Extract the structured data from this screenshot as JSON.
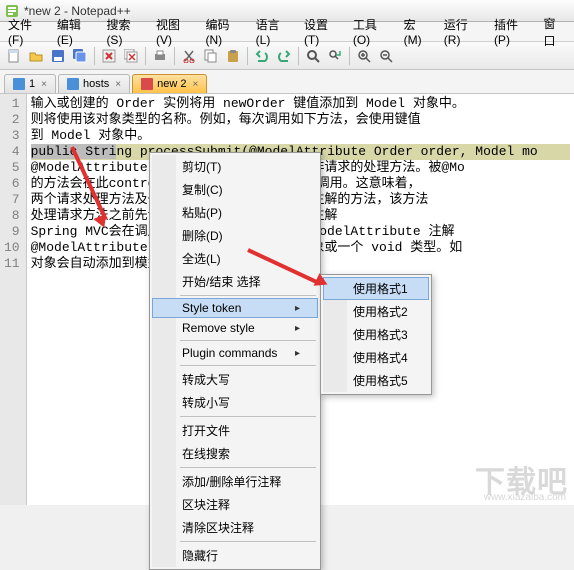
{
  "window": {
    "title": "*new 2 - Notepad++"
  },
  "menubar": {
    "items": [
      {
        "label": "文件(F)"
      },
      {
        "label": "编辑(E)"
      },
      {
        "label": "搜索(S)"
      },
      {
        "label": "视图(V)"
      },
      {
        "label": "编码(N)"
      },
      {
        "label": "语言(L)"
      },
      {
        "label": "设置(T)"
      },
      {
        "label": "工具(O)"
      },
      {
        "label": "宏(M)"
      },
      {
        "label": "运行(R)"
      },
      {
        "label": "插件(P)"
      },
      {
        "label": "窗口"
      }
    ]
  },
  "tabs": {
    "items": [
      {
        "label": "1",
        "active": false,
        "icon": "file-icon-blue"
      },
      {
        "label": "hosts",
        "active": false,
        "icon": "file-icon-blue"
      },
      {
        "label": "new 2",
        "active": true,
        "icon": "file-icon-red"
      }
    ]
  },
  "gutter": {
    "lines": [
      "1",
      "2",
      "3",
      "4",
      "5",
      "6",
      "7",
      "8",
      "9",
      "10",
      "11"
    ]
  },
  "code": {
    "lines": [
      "输入或创建的 Order 实例将用 newOrder 键值添加到 Model 对象中。",
      "则将使用该对象类型的名称。例如，每次调用如下方法，会使用键值",
      "到 Model 对象中。",
      "public String processSubmit(@ModelAttribute Order order, Model mo",
      "@ModelAttribute 注解也可以被用来标注一个非请求的处理方法。被@Mo",
      "的方法会在此controller每个请求处理方法时被调用。这意味着，",
      "两个请求处理方法及一个有@ModelAttribute 注解的方法，该方法",
      "处理请求方法之前先调用带@ModelAttribute 注解",
      "Spring MVC会在调用请求处理方法之前调用带@ModelAttribute 注解",
      "@ModelAttribute 注解的方法可以返回一个对象或一个 void 类型。如",
      "对象会自动添加到模型中。"
    ],
    "highlight_line_index": 3,
    "selection_text": "public Stri"
  },
  "context_menu": {
    "items": [
      {
        "label": "剪切(T)",
        "kind": "item"
      },
      {
        "label": "复制(C)",
        "kind": "item"
      },
      {
        "label": "粘贴(P)",
        "kind": "item"
      },
      {
        "label": "删除(D)",
        "kind": "item"
      },
      {
        "label": "全选(L)",
        "kind": "item"
      },
      {
        "label": "开始/结束 选择",
        "kind": "item"
      },
      {
        "kind": "sep"
      },
      {
        "label": "Style token",
        "kind": "submenu",
        "hover": true
      },
      {
        "label": "Remove style",
        "kind": "submenu"
      },
      {
        "kind": "sep"
      },
      {
        "label": "Plugin commands",
        "kind": "submenu"
      },
      {
        "kind": "sep"
      },
      {
        "label": "转成大写",
        "kind": "item"
      },
      {
        "label": "转成小写",
        "kind": "item"
      },
      {
        "kind": "sep"
      },
      {
        "label": "打开文件",
        "kind": "item"
      },
      {
        "label": "在线搜索",
        "kind": "item"
      },
      {
        "kind": "sep"
      },
      {
        "label": "添加/删除单行注释",
        "kind": "item"
      },
      {
        "label": "区块注释",
        "kind": "item"
      },
      {
        "label": "清除区块注释",
        "kind": "item"
      },
      {
        "kind": "sep"
      },
      {
        "label": "隐藏行",
        "kind": "item"
      }
    ]
  },
  "submenu": {
    "items": [
      {
        "label": "使用格式1",
        "hover": true
      },
      {
        "label": "使用格式2"
      },
      {
        "label": "使用格式3"
      },
      {
        "label": "使用格式4"
      },
      {
        "label": "使用格式5"
      }
    ]
  },
  "toolbar": {
    "icons": [
      "new-file-icon",
      "open-file-icon",
      "save-icon",
      "save-all-icon",
      "sep",
      "close-icon",
      "close-all-icon",
      "sep",
      "print-icon",
      "sep",
      "cut-icon",
      "copy-icon",
      "paste-icon",
      "sep",
      "undo-icon",
      "redo-icon",
      "sep",
      "find-icon",
      "replace-icon",
      "sep",
      "zoom-in-icon",
      "zoom-out-icon"
    ]
  },
  "watermark": {
    "text": "下载吧",
    "url": "www.xiazaiba.com"
  },
  "colors": {
    "tab_active_bg": "#ffc24a",
    "selection_bg": "#bcbcbc",
    "line_hl": "#d7d7a8",
    "menu_hover": "#c7ddf5",
    "arrow": "#e13030"
  }
}
